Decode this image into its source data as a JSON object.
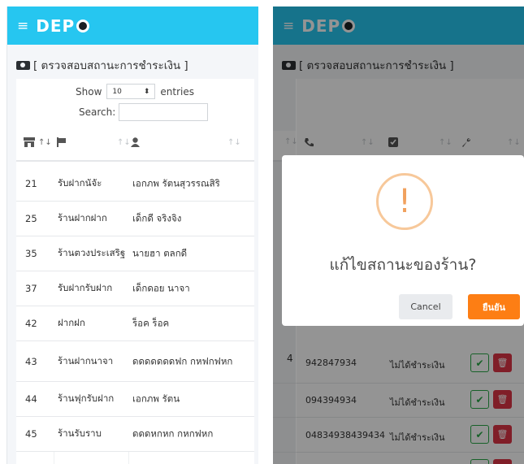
{
  "app": {
    "logo": "DEP"
  },
  "page_title": "[ ตรวจสอบสถานะการชำระเงิน ]",
  "controls": {
    "show_label": "Show",
    "entries_value": "10",
    "entries_label": "entries",
    "search_label": "Search:"
  },
  "rows": [
    {
      "id": "21",
      "shop": "รับฝากนัจัะ",
      "owner": "เอกภพ รัตนสุวรรณสิริ"
    },
    {
      "id": "25",
      "shop": "ร้านฝากฝาก",
      "owner": "เด็กดี จริงจิง"
    },
    {
      "id": "35",
      "shop": "ร้านตวงประเสริฐ",
      "owner": "นายฮา ตลกดี"
    },
    {
      "id": "37",
      "shop": "รับฝากรับฝาก",
      "owner": "เด็กดอย นาจา"
    },
    {
      "id": "42",
      "shop": "ฝากฝก",
      "owner": "ร็อค ร็อค"
    },
    {
      "id": "43",
      "shop": "ร้านฝากนาจา",
      "owner": "ดดดดดดดฟก กหฟกฟหก"
    },
    {
      "id": "44",
      "shop": "ร้านฟุกรับฝาก",
      "owner": "เอกภพ รัตน"
    },
    {
      "id": "45",
      "shop": "ร้านรับราบ",
      "owner": "ดดดหกหก กหกฟหก"
    }
  ],
  "right_rows": [
    {
      "phone": "942847934",
      "status": "ไม่ได้ชำระเงิน"
    },
    {
      "phone": "094394934",
      "status": "ไม่ได้ชำระเงิน"
    },
    {
      "phone": "04834938439434",
      "status": "ไม่ได้ชำระเงิน"
    }
  ],
  "modal": {
    "title": "แก้ไขสถานะของร้าน?",
    "cancel": "Cancel",
    "confirm": "ยืนยัน"
  },
  "colors": {
    "topbar": "#26c6f0",
    "confirm": "#fd7e14",
    "check": "#28a745",
    "delete": "#dc3545",
    "warning": "#f7c89a"
  },
  "icons": {
    "menu": "menu-icon",
    "money": "money-icon",
    "shop": "shop-icon",
    "flag": "flag-icon",
    "user": "user-icon",
    "phone": "phone-icon",
    "checkbox": "checkbox-icon",
    "wrench": "wrench-icon",
    "alert": "alert-icon",
    "check": "check-icon",
    "trash": "trash-icon"
  }
}
